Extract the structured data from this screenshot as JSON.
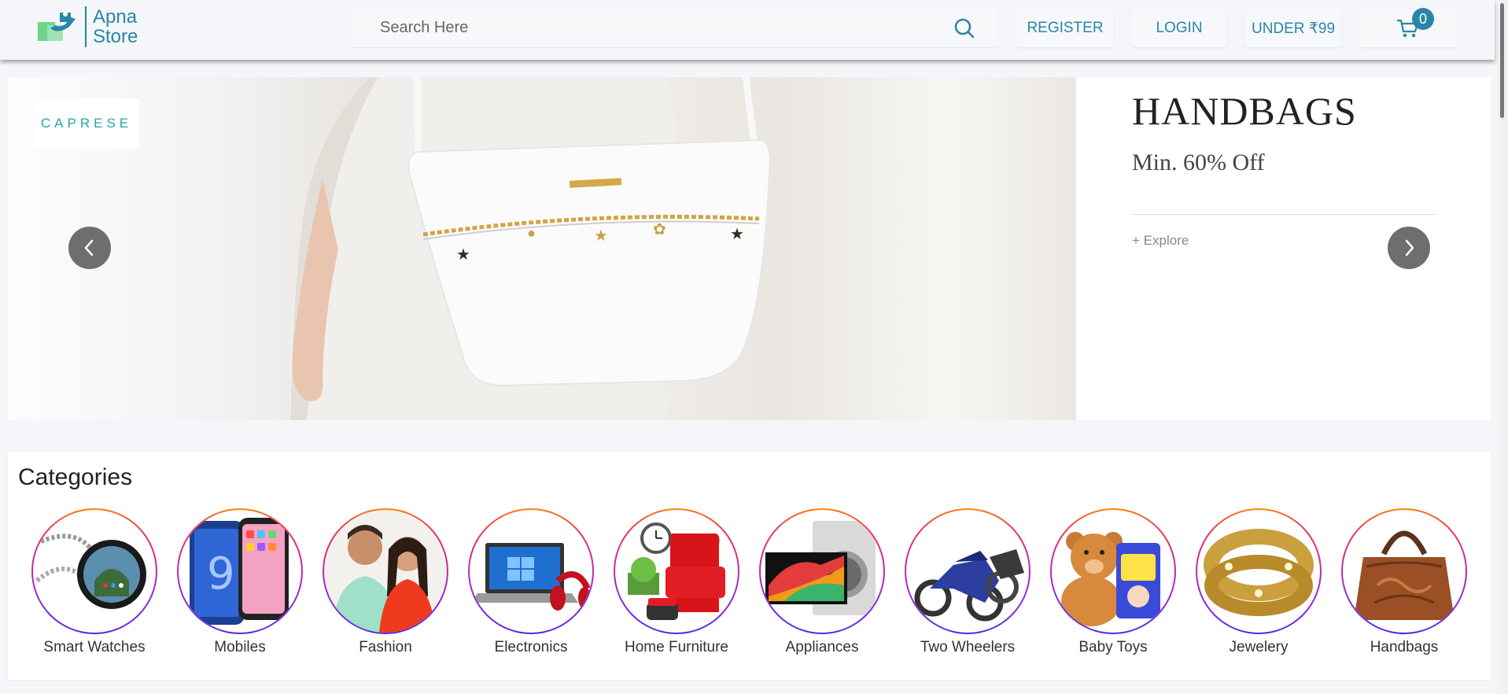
{
  "header": {
    "logo_line1": "Apna",
    "logo_line2": "Store",
    "search_placeholder": "Search Here",
    "nav": {
      "register": "REGISTER",
      "login": "LOGIN",
      "under99": "UNDER ₹99"
    },
    "cart_count": "0",
    "accent_color": "#2a86a8"
  },
  "banner": {
    "brand": "CAPRESE",
    "title": "HANDBAGS",
    "subtitle": "Min. 60% Off",
    "link": "+ Explore"
  },
  "categories": {
    "title": "Categories",
    "items": [
      {
        "label": "Smart Watches",
        "icon": "smartwatch-icon"
      },
      {
        "label": "Mobiles",
        "icon": "mobile-phone-icon"
      },
      {
        "label": "Fashion",
        "icon": "fashion-people-icon"
      },
      {
        "label": "Electronics",
        "icon": "laptop-icon"
      },
      {
        "label": "Home Furniture",
        "icon": "armchair-icon"
      },
      {
        "label": "Appliances",
        "icon": "tv-washer-icon"
      },
      {
        "label": "Two Wheelers",
        "icon": "motorbike-icon"
      },
      {
        "label": "Baby Toys",
        "icon": "teddy-bear-icon"
      },
      {
        "label": "Jewelery",
        "icon": "bracelet-icon"
      },
      {
        "label": "Handbags",
        "icon": "handbag-icon"
      }
    ]
  }
}
